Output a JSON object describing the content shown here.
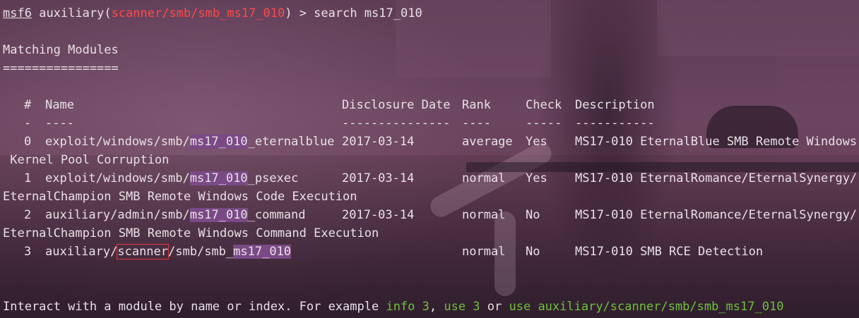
{
  "prompt": {
    "app": "msf6",
    "module_prefix": "auxiliary(",
    "module_path": "scanner/smb/smb_ms17_010",
    "module_suffix": ")",
    "command": " > search ms17_010"
  },
  "heading": "Matching Modules",
  "underline": "================",
  "columns": [
    "#",
    "Name",
    "Disclosure Date",
    "Rank",
    "Check",
    "Description"
  ],
  "dashes": [
    "-",
    "----",
    "---------------",
    "----",
    "-----",
    "-----------"
  ],
  "rows": [
    {
      "index": "0",
      "name_pre": "exploit/windows/smb/",
      "name_hl": "ms17_010",
      "name_post": "_eternalblue",
      "date": "2017-03-14",
      "rank": "average",
      "check": "Yes",
      "description": "MS17-010 EternalBlue SMB Remote Windows",
      "description_wrap": " Kernel Pool Corruption"
    },
    {
      "index": "1",
      "name_pre": "exploit/windows/smb/",
      "name_hl": "ms17_010",
      "name_post": "_psexec",
      "date": "2017-03-14",
      "rank": "normal",
      "check": "Yes",
      "description": "MS17-010 EternalRomance/EternalSynergy/",
      "description_wrap": "EternalChampion SMB Remote Windows Code Execution"
    },
    {
      "index": "2",
      "name_pre": "auxiliary/admin/smb/",
      "name_hl": "ms17_010",
      "name_post": "_command",
      "date": "2017-03-14",
      "rank": "normal",
      "check": "No",
      "description": "MS17-010 EternalRomance/EternalSynergy/",
      "description_wrap": "EternalChampion SMB Remote Windows Command Execution"
    },
    {
      "index": "3",
      "name_a": "auxiliary/",
      "name_box": "scanner",
      "name_b": "/smb/smb_",
      "name_hl": "ms17_010",
      "date": "",
      "rank": "normal",
      "check": "No",
      "description": "MS17-010 SMB RCE Detection"
    }
  ],
  "footer": {
    "text1": "Interact with a module by name or index. For example ",
    "cmd1": "info 3",
    "sep1": ", ",
    "cmd2": "use 3",
    "sep2": " or ",
    "cmd3": "use auxiliary/scanner/smb/smb_ms17_010"
  },
  "colors": {
    "prompt_module": "#ff4a4a",
    "highlight_bg": "#7a4a86",
    "command_green": "#6ec03b",
    "text": "#e9e1e6"
  }
}
